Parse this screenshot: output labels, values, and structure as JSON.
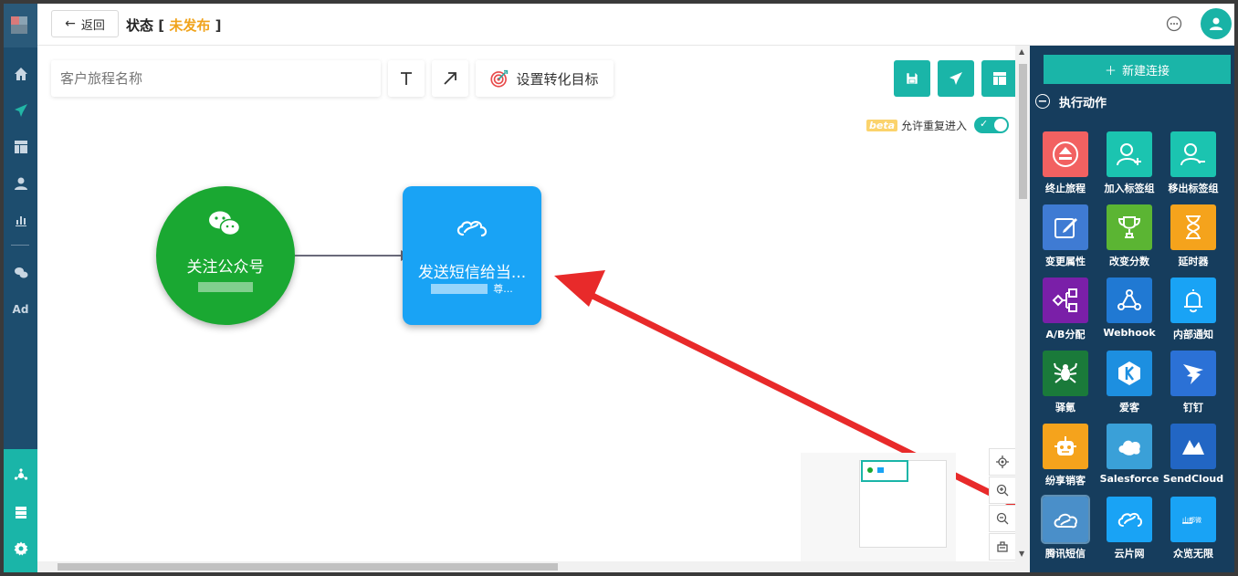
{
  "header": {
    "back_label": "返回",
    "status_label": "状态",
    "status_value": "未发布",
    "bracket_open": "[",
    "bracket_close": "]"
  },
  "left_nav": {
    "items": [
      "home-icon",
      "send-icon",
      "layout-icon",
      "user-icon",
      "chart-icon",
      "wechat-icon",
      "Ad"
    ],
    "bottom_items": [
      "hub-icon",
      "server-icon",
      "gear-icon"
    ],
    "ad_label": "Ad"
  },
  "toolbar": {
    "name_placeholder": "客户旅程名称",
    "text_tool_icon": "text-icon",
    "arrow_tool_icon": "arrow-icon",
    "goal_label": "设置转化目标",
    "actions": [
      "save-icon",
      "publish-icon",
      "layout-icon"
    ]
  },
  "reentry": {
    "beta_tag": "beta",
    "label": "允许重复进入",
    "enabled": true
  },
  "nodes": {
    "trigger": {
      "label": "关注公众号",
      "icon": "wechat-icon",
      "color": "#1aa832"
    },
    "action": {
      "label": "发送短信给当...",
      "suffix": "尊...",
      "icon": "cloud-sms-icon",
      "color": "#19a3f5"
    }
  },
  "right_panel": {
    "new_connection_label": "新建连接",
    "section_title": "执行动作",
    "tiles": [
      {
        "label": "终止旅程",
        "color": "#f26161",
        "icon": "eject-icon"
      },
      {
        "label": "加入标签组",
        "color": "#1bc4b0",
        "icon": "user-add-icon"
      },
      {
        "label": "移出标签组",
        "color": "#1bc4b0",
        "icon": "user-remove-icon"
      },
      {
        "label": "变更属性",
        "color": "#3f7bd3",
        "icon": "edit-icon"
      },
      {
        "label": "改变分数",
        "color": "#5bb533",
        "icon": "trophy-icon"
      },
      {
        "label": "延时器",
        "color": "#f5a31c",
        "icon": "hourglass-icon"
      },
      {
        "label": "A/B分配",
        "color": "#7a1fa8",
        "icon": "ab-split-icon"
      },
      {
        "label": "Webhook",
        "color": "#2079d3",
        "icon": "webhook-icon"
      },
      {
        "label": "内部通知",
        "color": "#19a3f5",
        "icon": "bell-icon"
      },
      {
        "label": "驿氪",
        "color": "#1a7a3a",
        "icon": "spider-icon"
      },
      {
        "label": "爱客",
        "color": "#1d8fe0",
        "icon": "k-icon"
      },
      {
        "label": "钉钉",
        "color": "#2b71d6",
        "icon": "dingtalk-icon"
      },
      {
        "label": "纷享销客",
        "color": "#f5a31c",
        "icon": "robot-icon"
      },
      {
        "label": "Salesforce",
        "color": "#3aa0d8",
        "icon": "salesforce-icon"
      },
      {
        "label": "SendCloud",
        "color": "#2266c4",
        "icon": "sendcloud-icon"
      },
      {
        "label": "腾讯短信",
        "color": "#4a8fc9",
        "icon": "cloud-icon"
      },
      {
        "label": "云片网",
        "color": "#19a3f5",
        "icon": "cloud-sms-icon"
      },
      {
        "label": "众览无限",
        "color": "#19a3f5",
        "icon": "weiwei-icon"
      }
    ],
    "weiwei_text": "山都微"
  },
  "canvas_controls": [
    "locate-icon",
    "zoom-in-icon",
    "zoom-out-icon",
    "fit-icon"
  ]
}
